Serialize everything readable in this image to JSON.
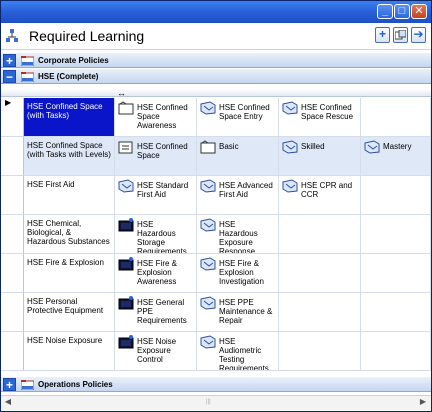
{
  "window": {
    "controls": {
      "minimize": "_",
      "maximize": "□",
      "close": "✕"
    }
  },
  "header": {
    "title": "Required Learning",
    "buttons": [
      "add-icon",
      "view-icon",
      "next-icon"
    ]
  },
  "groups": {
    "corporate": {
      "label": "Corporate Policies",
      "toggle": "+"
    },
    "hse": {
      "label": "HSE (Complete)",
      "toggle": "−"
    },
    "operations": {
      "label": "Operations Policies",
      "toggle": "+"
    }
  },
  "grid": {
    "resize_glyph": "↔",
    "row_pointer": "▶",
    "rows": [
      {
        "name": "HSE Confined Space (with Tasks)",
        "items": [
          {
            "icon": "module-icon",
            "label": "HSE Confined Space Awareness"
          },
          {
            "icon": "course-icon",
            "label": "HSE Confined Space Entry"
          },
          {
            "icon": "course-icon",
            "label": "HSE Confined Space Rescue"
          }
        ]
      },
      {
        "name": "HSE Confined Space (with Tasks with Levels)",
        "items": [
          {
            "icon": "document-icon",
            "label": "HSE Confined Space"
          },
          {
            "icon": "module-icon",
            "label": "Basic"
          },
          {
            "icon": "course-icon",
            "label": "Skilled"
          },
          {
            "icon": "course-icon",
            "label": "Mastery"
          }
        ]
      },
      {
        "name": "HSE First Aid",
        "items": [
          {
            "icon": "course-icon",
            "label": "HSE Standard First Aid"
          },
          {
            "icon": "course-icon",
            "label": "HSE Advanced First Aid"
          },
          {
            "icon": "course-icon",
            "label": "HSE CPR and CCR"
          }
        ]
      },
      {
        "name": "HSE Chemical, Biological, & Hazardous Substances",
        "items": [
          {
            "icon": "video-icon",
            "label": "HSE Hazardous Storage Requirements"
          },
          {
            "icon": "course-icon",
            "label": "HSE Hazardous Exposure Response"
          }
        ]
      },
      {
        "name": "HSE Fire & Explosion",
        "items": [
          {
            "icon": "video-icon",
            "label": "HSE Fire & Explosion Awareness"
          },
          {
            "icon": "course-icon",
            "label": "HSE Fire & Explosion Investigation"
          }
        ]
      },
      {
        "name": "HSE Personal Protective Equipment",
        "items": [
          {
            "icon": "video-icon",
            "label": "HSE General PPE Requirements"
          },
          {
            "icon": "course-icon",
            "label": "HSE PPE Maintenance & Repair"
          }
        ]
      },
      {
        "name": "HSE Noise Exposure",
        "items": [
          {
            "icon": "video-icon",
            "label": "HSE Noise Exposure Control"
          },
          {
            "icon": "course-icon",
            "label": "HSE Audiometric Testing Requirements"
          }
        ]
      }
    ]
  },
  "scrollbar": {
    "left": "◀",
    "right": "▶",
    "grip": "|||"
  },
  "colors": {
    "title_bar": "#2a5fd8",
    "selection": "#0a14c8",
    "group_bar": "#c4d6ef"
  }
}
